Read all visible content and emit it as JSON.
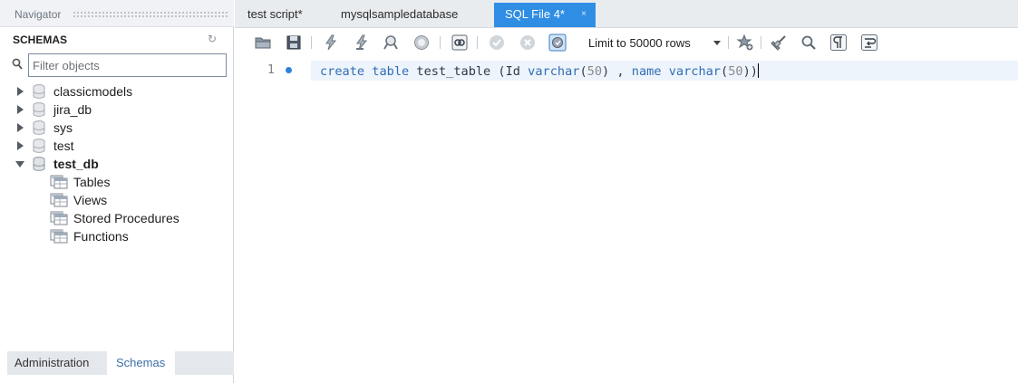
{
  "navigator": {
    "title": "Navigator",
    "schemas_label": "SCHEMAS",
    "filter_placeholder": "Filter objects",
    "databases": [
      {
        "name": "classicmodels"
      },
      {
        "name": "jira_db"
      },
      {
        "name": "sys"
      },
      {
        "name": "test"
      },
      {
        "name": "test_db",
        "expanded": true,
        "children": [
          "Tables",
          "Views",
          "Stored Procedures",
          "Functions"
        ]
      }
    ],
    "bottom_tabs": {
      "administration": "Administration",
      "schemas": "Schemas"
    }
  },
  "editor": {
    "tabs": [
      {
        "label": "test script*"
      },
      {
        "label": "mysqlsampledatabase"
      },
      {
        "label": "SQL File 4*",
        "active": true,
        "close": "×"
      }
    ],
    "toolbar": {
      "limit_value": "Limit to 50000 rows"
    },
    "line_number": "1",
    "code": {
      "t1": "create table",
      "t2": " test_table (Id ",
      "t3": "varchar",
      "t4": "(",
      "t5": "50",
      "t6": ") , ",
      "t7": "name varchar",
      "t8": "(",
      "t9": "50",
      "t10": "))"
    }
  },
  "colors": {
    "accent": "#2f8ee3",
    "keyword": "#2f6db5",
    "dot": "#2f82d8"
  }
}
